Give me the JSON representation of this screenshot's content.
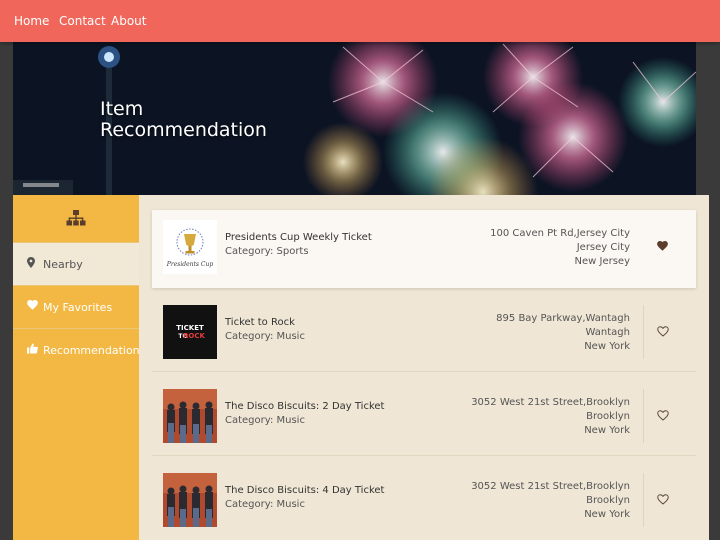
{
  "nav": {
    "items": [
      {
        "label": "Home"
      },
      {
        "label": "Contact"
      },
      {
        "label": "About"
      }
    ]
  },
  "hero": {
    "title_line1": "Item",
    "title_line2": "Recommendation"
  },
  "sidebar": {
    "top_icon": "sitemap-icon",
    "items": [
      {
        "label": "Nearby",
        "icon": "map-marker-icon",
        "active": true
      },
      {
        "label": "My Favorites",
        "icon": "heart-icon",
        "active": false
      },
      {
        "label": "Recommendation",
        "icon": "thumbs-up-icon",
        "active": false
      }
    ]
  },
  "items": [
    {
      "name": "Presidents Cup Weekly Ticket",
      "category": "Category: Sports",
      "address": [
        "100 Caven Pt Rd,Jersey City",
        "Jersey City",
        "New Jersey"
      ],
      "favorited": true,
      "thumb": "presidents-cup-logo"
    },
    {
      "name": "Ticket to Rock",
      "category": "Category: Music",
      "address": [
        "895 Bay Parkway,Wantagh",
        "Wantagh",
        "New York"
      ],
      "favorited": false,
      "thumb": "ticket-to-rock-logo"
    },
    {
      "name": "The Disco Biscuits: 2 Day Ticket",
      "category": "Category: Music",
      "address": [
        "3052 West 21st Street,Brooklyn",
        "Brooklyn",
        "New York"
      ],
      "favorited": false,
      "thumb": "band-photo"
    },
    {
      "name": "The Disco Biscuits: 4 Day Ticket",
      "category": "Category: Music",
      "address": [
        "3052 West 21st Street,Brooklyn",
        "Brooklyn",
        "New York"
      ],
      "favorited": false,
      "thumb": "band-photo"
    }
  ],
  "thumb_text": {
    "presidents_cup": "Presidents Cup",
    "ticket_to_rock_l1": "TICKET",
    "ticket_to_rock_l2": "TO",
    "ticket_to_rock_l3": "ROCK"
  },
  "colors": {
    "nav": "#f0665a",
    "sidebar": "#f2b843",
    "content_bg": "#efe6d5",
    "card_selected": "#fbf8f3",
    "heart": "#5a3e2b"
  }
}
